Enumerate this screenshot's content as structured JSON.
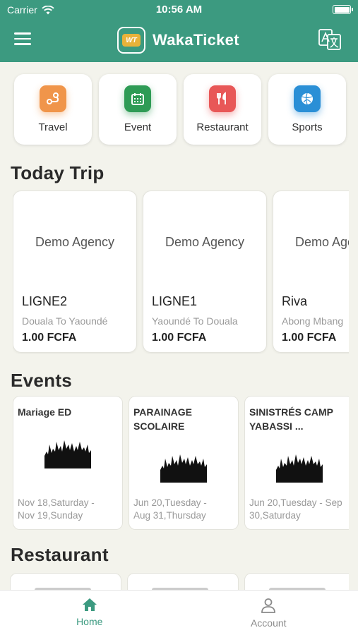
{
  "status_bar": {
    "carrier": "Carrier",
    "time": "10:56 AM"
  },
  "header": {
    "app_name": "WakaTicket",
    "logo_text": "WT",
    "brand_color": "#3c9a80"
  },
  "categories": [
    {
      "label": "Travel",
      "icon": "travel-icon",
      "color": "#f0954a"
    },
    {
      "label": "Event",
      "icon": "calendar-icon",
      "color": "#2e9b55"
    },
    {
      "label": "Restaurant",
      "icon": "restaurant-icon",
      "color": "#e85757"
    },
    {
      "label": "Sports",
      "icon": "sports-icon",
      "color": "#2a8fd6"
    }
  ],
  "sections": {
    "trips": "Today Trip",
    "events": "Events",
    "restaurant": "Restaurant"
  },
  "trips": [
    {
      "agency": "Demo Agency",
      "line": "LIGNE2",
      "route": "Douala To Yaoundé",
      "price": "1.00 FCFA"
    },
    {
      "agency": "Demo Agency",
      "line": "LIGNE1",
      "route": "Yaoundé To Douala",
      "price": "1.00 FCFA"
    },
    {
      "agency": "Demo Agency",
      "line": "Riva",
      "route": "Abong Mbang",
      "price": "1.00 FCFA"
    }
  ],
  "events": [
    {
      "title": "Mariage  ED",
      "date": "Nov 18,Saturday -\nNov 19,Sunday"
    },
    {
      "title": "PARAINAGE\nSCOLAIRE",
      "date": "Jun 20,Tuesday -\nAug 31,Thursday"
    },
    {
      "title": "SINISTRÉS CAMP\nYABASSI ...",
      "date": "Jun 20,Tuesday - Sep\n30,Saturday"
    }
  ],
  "tabbar": {
    "home": "Home",
    "account": "Account",
    "active_color": "#3c9a80"
  }
}
